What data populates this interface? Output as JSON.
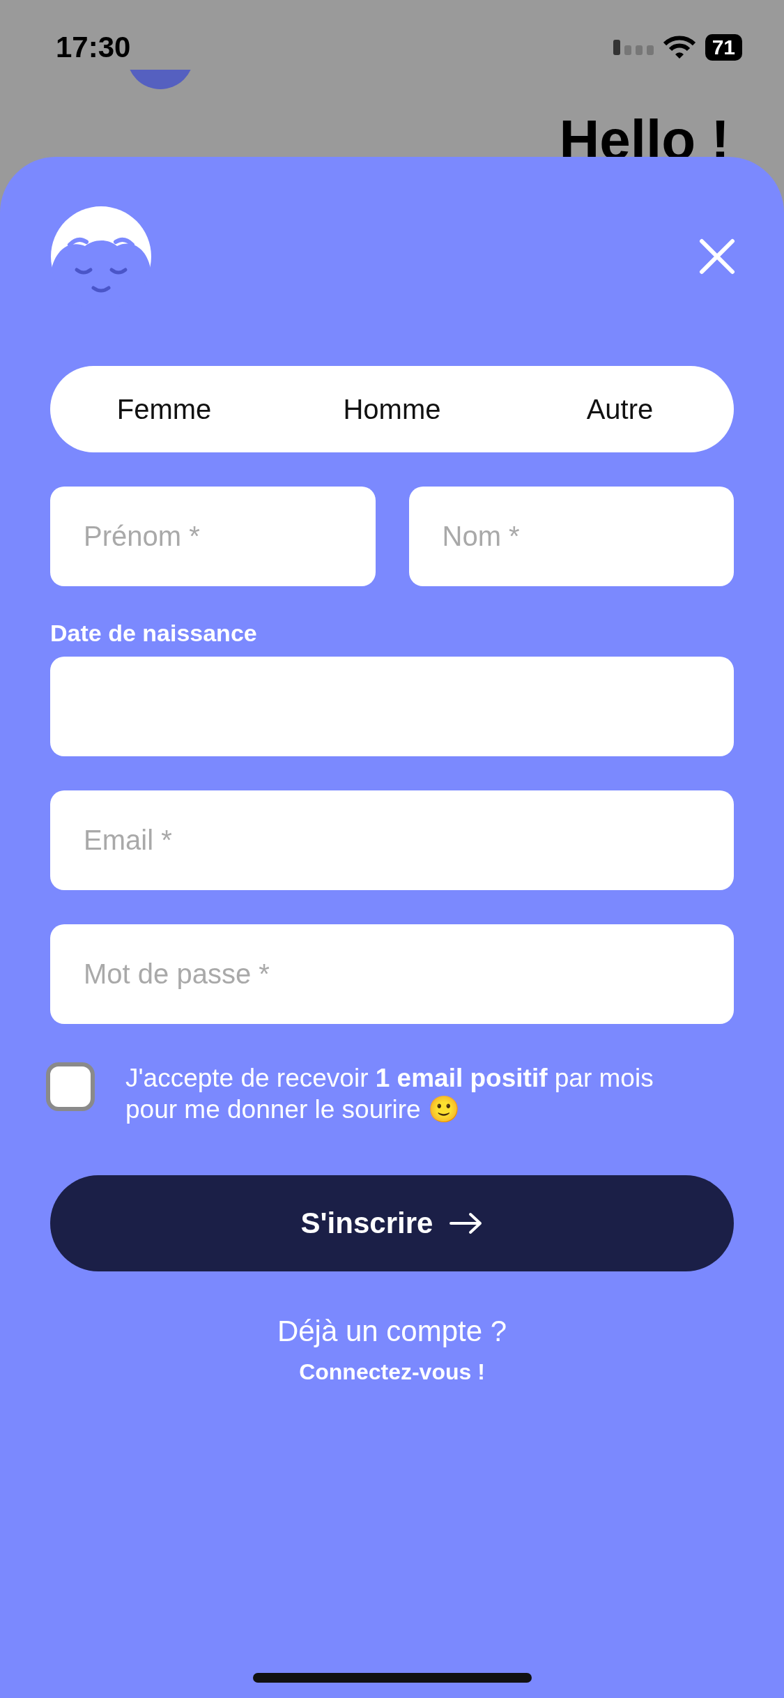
{
  "status_bar": {
    "time": "17:30",
    "battery": "71"
  },
  "background": {
    "title": "Hello !"
  },
  "gender_options": [
    {
      "label": "Femme",
      "selected": false
    },
    {
      "label": "Homme",
      "selected": false
    },
    {
      "label": "Autre",
      "selected": false
    }
  ],
  "name_fields": [
    {
      "placeholder": "Prénom *"
    },
    {
      "placeholder": "Nom *"
    }
  ],
  "birth_date": {
    "label": "Date de naissance"
  },
  "fields": [
    {
      "placeholder": "Email *"
    },
    {
      "placeholder": "Mot de passe *"
    }
  ],
  "newsletter": {
    "text": "J'accepte de recevoir **1 email positif** par mois pour me donner le sourire 🙂",
    "checked": false
  },
  "submit": {
    "label": "S'inscrire"
  },
  "login": {
    "question": "Déjà un compte ?",
    "link": "Connectez-vous !"
  }
}
